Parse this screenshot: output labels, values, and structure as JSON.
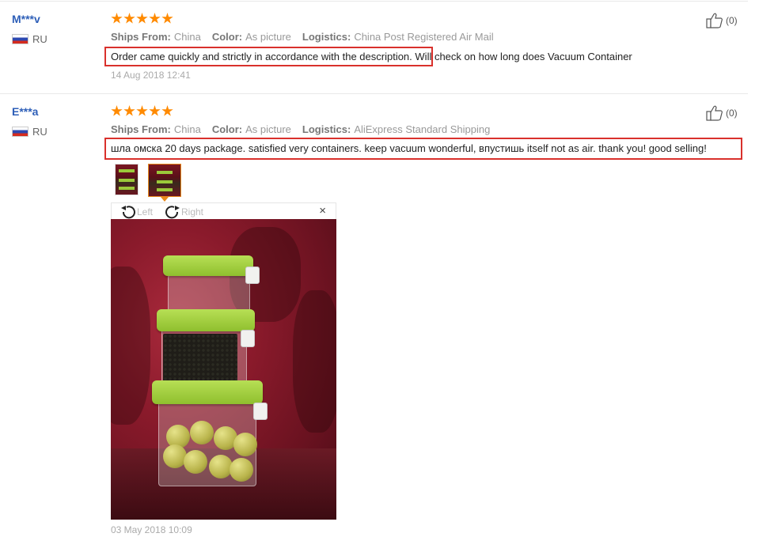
{
  "reviews": [
    {
      "user": "M***v",
      "country": "RU",
      "helpful_count": "(0)",
      "meta": {
        "ships_from_label": "Ships From:",
        "ships_from": "China",
        "color_label": "Color:",
        "color": "As picture",
        "logistics_label": "Logistics:",
        "logistics": "China Post Registered Air Mail"
      },
      "text_highlighted": "Order came quickly and strictly in accordance with the description.",
      "text_rest": "Will check on how long does Vacuum Container",
      "date": "14 Aug 2018 12:41"
    },
    {
      "user": "E***a",
      "country": "RU",
      "helpful_count": "(0)",
      "meta": {
        "ships_from_label": "Ships From:",
        "ships_from": "China",
        "color_label": "Color:",
        "color": "As picture",
        "logistics_label": "Logistics:",
        "logistics": "AliExpress Standard Shipping"
      },
      "text_highlighted": "шла омска 20 days package. satisfied very containers. keep vacuum wonderful, впустишь itself not as air. thank you! good selling!",
      "viewer": {
        "rotate_left": "Left",
        "rotate_right": "Right",
        "close": "×"
      },
      "date": "03 May 2018 10:09"
    }
  ],
  "colors": {
    "highlight": "#d9312c",
    "star": "#ff8a00",
    "username": "#2e5fb8",
    "thumb_active": "#e8891c"
  }
}
